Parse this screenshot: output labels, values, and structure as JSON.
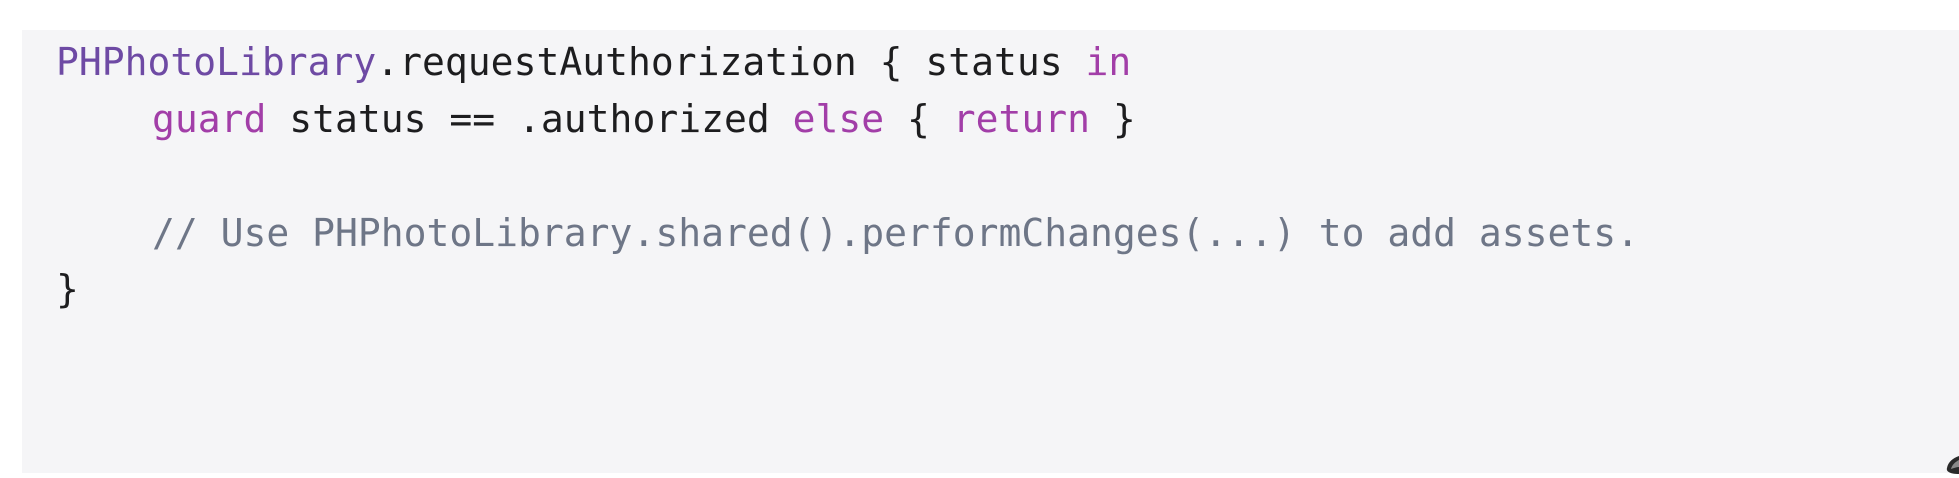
{
  "code": {
    "line1": {
      "type_name": "PHPhotoLibrary",
      "call": ".requestAuthorization { status ",
      "keyword": "in"
    },
    "line2": {
      "kw_guard": "guard",
      "condition": " status == .authorized ",
      "kw_else": "else",
      "open_brace": " { ",
      "kw_return": "return",
      "close_brace": " }"
    },
    "line3": {
      "comment": "// Use PHPhotoLibrary.shared().performChanges(...) to add assets."
    },
    "line4": {
      "closing": "}"
    }
  },
  "colors": {
    "background": "#f5f5f7",
    "type": "#6e4aa4",
    "keyword": "#a23ea8",
    "plain": "#1d1d1f",
    "comment": "#6e7687"
  }
}
